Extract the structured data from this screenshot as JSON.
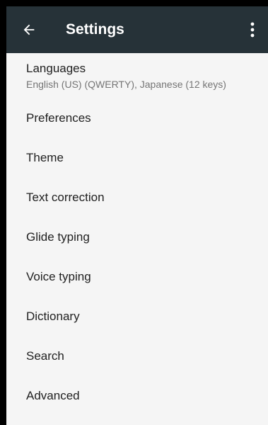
{
  "appbar": {
    "title": "Settings",
    "back_icon": "arrow-back-icon",
    "overflow_icon": "more-vert-icon",
    "color": "#263238"
  },
  "settings": {
    "items": [
      {
        "label": "Languages",
        "summary": "English (US) (QWERTY), Japanese (12 keys)"
      },
      {
        "label": "Preferences"
      },
      {
        "label": "Theme"
      },
      {
        "label": "Text correction"
      },
      {
        "label": "Glide typing"
      },
      {
        "label": "Voice typing"
      },
      {
        "label": "Dictionary"
      },
      {
        "label": "Search"
      },
      {
        "label": "Advanced"
      }
    ]
  }
}
